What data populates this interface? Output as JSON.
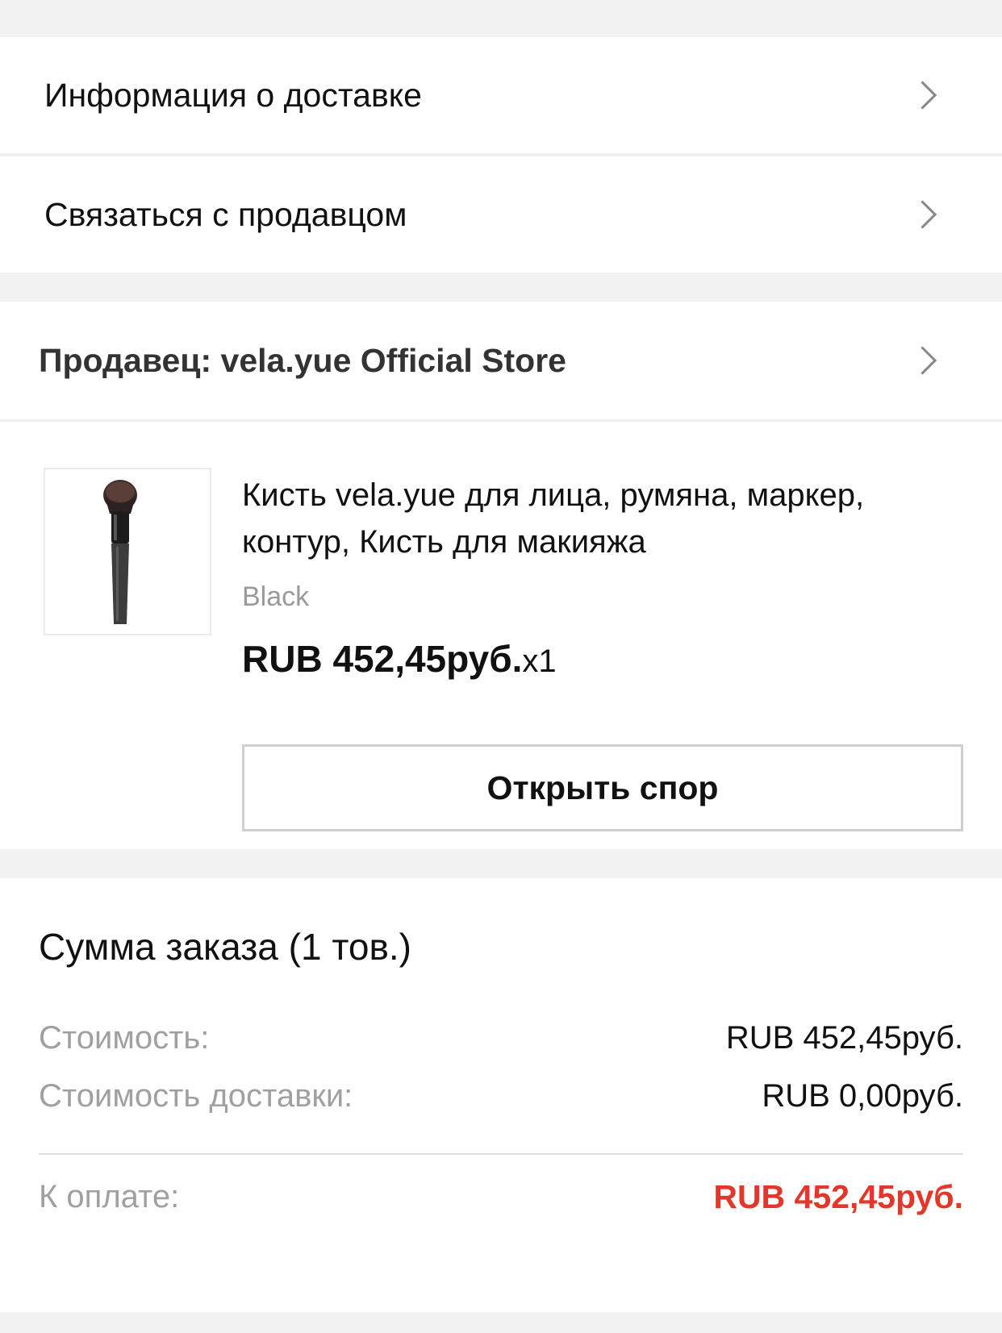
{
  "menu": {
    "delivery_info": "Информация о доставке",
    "contact_seller": "Связаться с продавцом"
  },
  "seller": {
    "label": "Продавец: vela.yue Official Store"
  },
  "product": {
    "title": "Кисть vela.yue для лица, румяна, маркер, контур, Кисть для макияжа",
    "variant": "Black",
    "price": "RUB 452,45руб.",
    "quantity": "x1",
    "dispute_button": "Открыть спор"
  },
  "summary": {
    "title": "Сумма заказа (1 тов.)",
    "cost_label": "Стоимость:",
    "cost_value": "RUB 452,45руб.",
    "shipping_label": "Стоимость доставки:",
    "shipping_value": "RUB 0,00руб.",
    "total_label": "К оплате:",
    "total_value": "RUB 452,45руб."
  },
  "colors": {
    "accent_red": "#e4372c",
    "background": "#f2f2f2"
  },
  "icons": {
    "chevron": "chevron-right-icon",
    "product_image": "makeup-brush-image"
  }
}
